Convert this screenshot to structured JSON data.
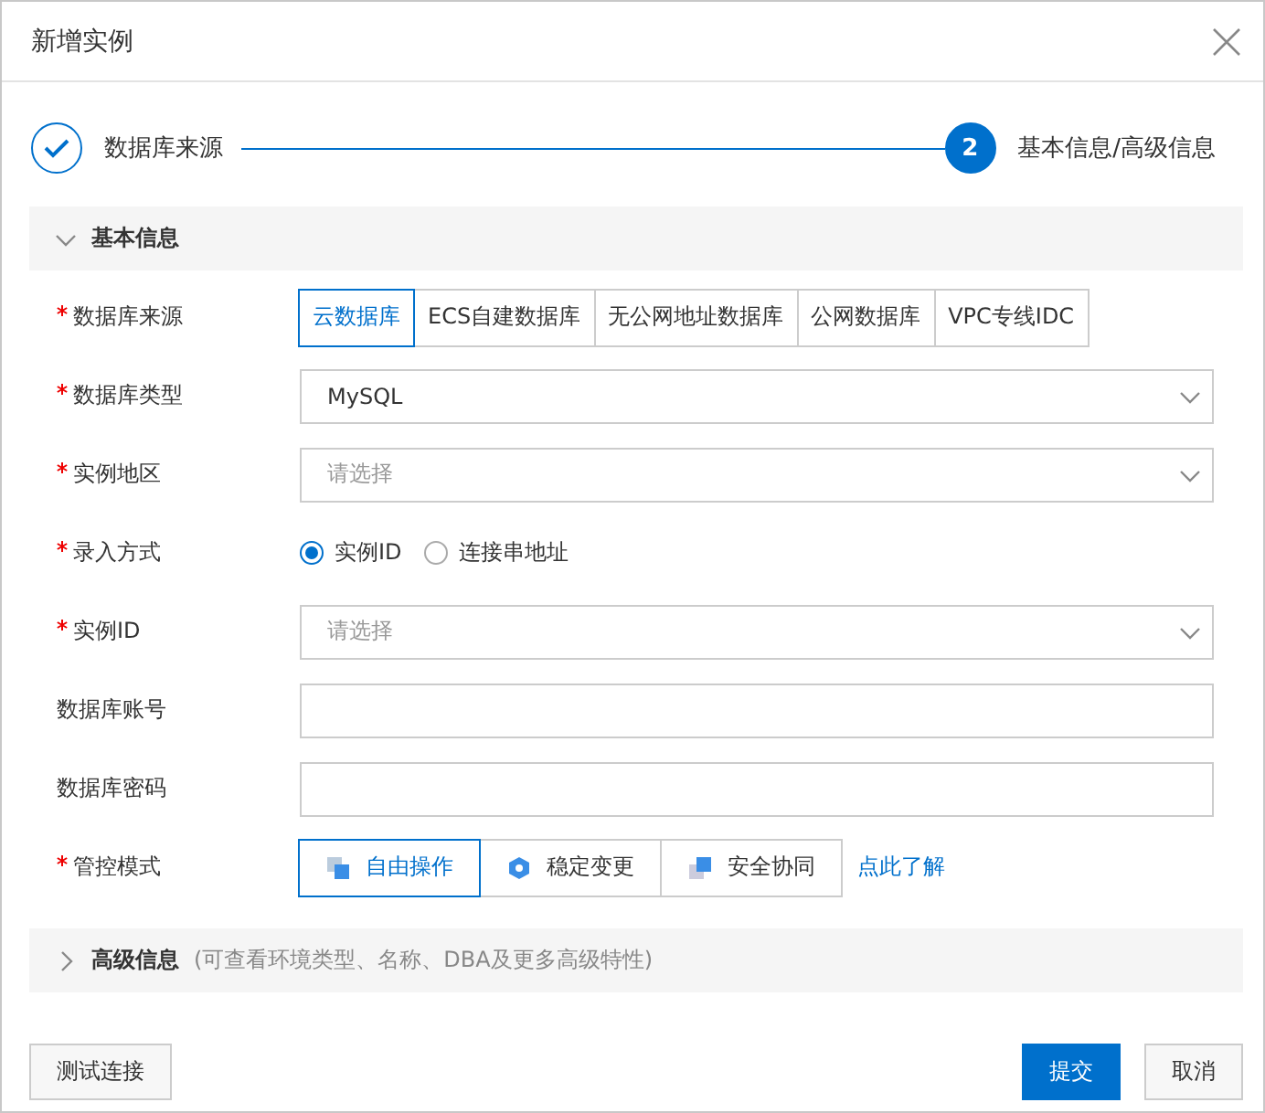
{
  "dialog": {
    "title": "新增实例"
  },
  "steps": [
    {
      "label": "数据库来源",
      "completed": true
    },
    {
      "label": "基本信息/高级信息",
      "number": "2",
      "completed": false
    }
  ],
  "basic_section": {
    "title": "基本信息",
    "expanded": true
  },
  "form": [
    {
      "label": "数据库来源",
      "required": true,
      "kind": "segmented",
      "options": [
        {
          "label": "云数据库",
          "selected": true
        },
        {
          "label": "ECS自建数据库",
          "selected": false
        },
        {
          "label": "无公网地址数据库",
          "selected": false
        },
        {
          "label": "公网数据库",
          "selected": false
        },
        {
          "label": "VPC专线IDC",
          "selected": false
        }
      ]
    },
    {
      "label": "数据库类型",
      "required": true,
      "kind": "select",
      "value": "MySQL"
    },
    {
      "label": "实例地区",
      "required": true,
      "kind": "select",
      "placeholder": "请选择"
    },
    {
      "label": "录入方式",
      "required": true,
      "kind": "radio",
      "options": [
        {
          "label": "实例ID",
          "selected": true
        },
        {
          "label": "连接串地址",
          "selected": false
        }
      ]
    },
    {
      "label": "实例ID",
      "required": true,
      "kind": "select",
      "placeholder": "请选择"
    },
    {
      "label": "数据库账号",
      "required": false,
      "kind": "input"
    },
    {
      "label": "数据库密码",
      "required": false,
      "kind": "input"
    },
    {
      "label": "管控模式",
      "required": true,
      "kind": "modes",
      "options": [
        {
          "label": "自由操作",
          "selected": true
        },
        {
          "label": "稳定变更",
          "selected": false
        },
        {
          "label": "安全协同",
          "selected": false
        }
      ],
      "link": "点此了解"
    }
  ],
  "advanced_section": {
    "title": "高级信息",
    "hint": "(可查看环境类型、名称、DBA及更多高级特性)",
    "expanded": false
  },
  "footer": {
    "test_button": "测试连接",
    "submit_button": "提交",
    "cancel_button": "取消"
  }
}
